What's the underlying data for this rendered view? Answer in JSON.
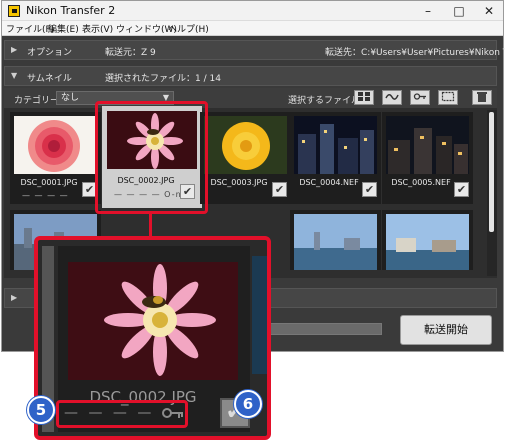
{
  "window": {
    "title": "Nikon Transfer 2",
    "minimize_icon": "minimize-icon",
    "maximize_icon": "maximize-icon",
    "close_icon": "close-icon"
  },
  "menu": [
    "ファイル(F)",
    "編集(E)",
    "表示(V)",
    "ウィンドウ(W)",
    "ヘルプ(H)"
  ],
  "options_bar": {
    "label": "オプション",
    "source": "転送元：Z 9",
    "destination": "転送先：C:¥Users¥User¥Pictures¥Nikon Transfer 2"
  },
  "thumbs_bar": {
    "label": "サムネイル",
    "selected_count": "選択されたファイル：1 / 14"
  },
  "category": {
    "label": "カテゴリー：",
    "value": "なし"
  },
  "select_files_label": "選択するファイル：",
  "tool_icons": [
    "select-all-icon",
    "select-wave-icon",
    "select-key-icon",
    "select-frame-icon",
    "trash-icon"
  ],
  "thumbnails": [
    {
      "name": "DSC_0001.JPG",
      "checked": true,
      "selected": false,
      "protected": false,
      "dashes": "— — — —"
    },
    {
      "name": "DSC_0002.JPG",
      "checked": true,
      "selected": true,
      "protected": true,
      "dashes": "— — — — O-n"
    },
    {
      "name": "DSC_0003.JPG",
      "checked": true,
      "selected": false,
      "protected": false,
      "dashes": ""
    },
    {
      "name": "DSC_0004.NEF",
      "checked": true,
      "selected": false,
      "protected": false,
      "dashes": ""
    },
    {
      "name": "DSC_0005.NEF",
      "checked": true,
      "selected": false,
      "protected": false,
      "dashes": ""
    }
  ],
  "transfer_button": "転送開始",
  "zoom": {
    "filename": "DSC_0002.JPG",
    "dashes": "— — — —",
    "key_icon": "key-icon",
    "check_icon": "checkmark-icon"
  },
  "badges": [
    "5",
    "6"
  ],
  "colors": {
    "callout": "#e2102a",
    "badge": "#2f62c8",
    "panel_bg": "#3a3a3a"
  }
}
